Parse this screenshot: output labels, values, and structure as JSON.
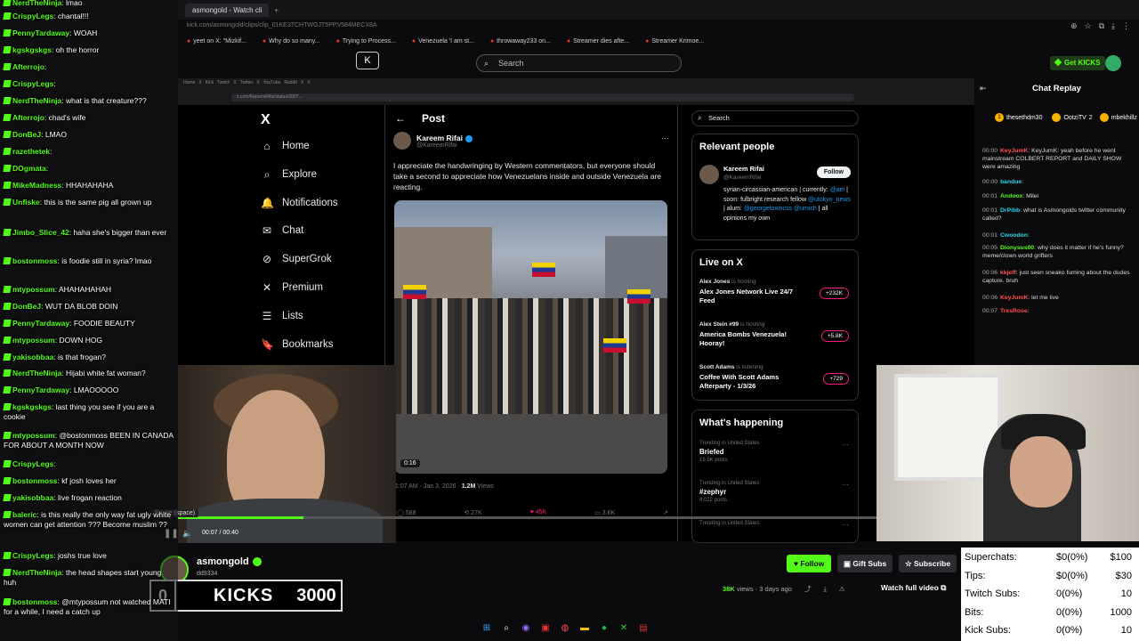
{
  "topbar": {
    "tab1": "asmongold - Watch cli",
    "tab2": "+",
    "url": "kick.com/asmongold/clips/clip_01KE3TCHTWGJT5PPV584MECX8A"
  },
  "bookmarks": [
    "yeet on X: \"Mizkif...",
    "Why do so many...",
    "Trying to Process...",
    "Venezuela 'I am st...",
    "throwaway233 on...",
    "Streamer dies afte...",
    "Streamer Krimoe..."
  ],
  "kick": {
    "logo_text": "K",
    "search_placeholder": "Search",
    "get_kicks": "Get KICKS"
  },
  "inner": {
    "address": "x.com/KareemRifai/status/2007...",
    "tabs": [
      "Home",
      "X",
      "Kick",
      "Twitch",
      "X",
      "Twitter",
      "X",
      "YouTube",
      "Reddit",
      "X",
      "X"
    ]
  },
  "x": {
    "logo": "X",
    "nav": [
      {
        "icon": "home-icon",
        "glyph": "⌂",
        "label": "Home"
      },
      {
        "icon": "explore-icon",
        "glyph": "⌕",
        "label": "Explore"
      },
      {
        "icon": "notifications-icon",
        "glyph": "🔔",
        "label": "Notifications"
      },
      {
        "icon": "chat-icon",
        "glyph": "✉",
        "label": "Chat"
      },
      {
        "icon": "supergrok-icon",
        "glyph": "⊘",
        "label": "SuperGrok"
      },
      {
        "icon": "premium-icon",
        "glyph": "✕",
        "label": "Premium"
      },
      {
        "icon": "lists-icon",
        "glyph": "☰",
        "label": "Lists"
      },
      {
        "icon": "bookmarks-icon",
        "glyph": "🔖",
        "label": "Bookmarks"
      }
    ],
    "post": {
      "back": "←",
      "header": "Post",
      "author": "Kareem Rifai",
      "handle": "@KareemRifai",
      "text": "I appreciate the handwringing by Western commentators, but everyone should take a second to appreciate how Venezuelans inside and outside Venezuela are reacting.",
      "video_time": "0:16",
      "meta_time": "1:07 AM · Jan 3, 2026 · ",
      "views": "1.2M",
      "views_label": " Views",
      "actions": [
        "588",
        "27K",
        "45K",
        "3.6K",
        "↗"
      ]
    },
    "search": "Search",
    "relevant": {
      "title": "Relevant people",
      "name": "Kareem Rifai",
      "handle": "@KareemRifai",
      "follow": "Follow",
      "bio_a": "syrian-circassian-american | currently: ",
      "bio_link1": "@aei",
      "bio_b": " | soon: fulbright research fellow ",
      "bio_link2": "@utokyo_news",
      "bio_c": " | alum: ",
      "bio_link3": "@georgetowncss @umich",
      "bio_d": " | all opinions my own"
    },
    "live": {
      "title": "Live on X",
      "items": [
        {
          "who": "Alex Jones",
          "status": " is hosting",
          "title": "Alex Jones Network Live 24/7 Feed",
          "count": "+232K"
        },
        {
          "who": "Alex Stein #99",
          "status": " is hosting",
          "title": "America Bombs Venezuela! Hooray!",
          "count": "+5.8K"
        },
        {
          "who": "Scott Adams",
          "status": " is listening",
          "title": "Coffee With Scott Adams Afterparty - 1/3/26",
          "count": "+729"
        }
      ]
    },
    "happening": {
      "title": "What's happening",
      "trends": [
        {
          "cat": "Trending in United States",
          "name": "Briefed",
          "posts": "19.5K posts"
        },
        {
          "cat": "Trending in United States",
          "name": "#zephyr",
          "posts": "4,022 posts"
        },
        {
          "cat": "Trending in United States",
          "name": "",
          "posts": ""
        }
      ]
    }
  },
  "player": {
    "pause_tip": "Pause (space)",
    "time": "00:07 / 00:40",
    "progress": 0.18
  },
  "channel": {
    "name": "asmongold",
    "sub": "dd9334",
    "follow": "Follow",
    "gift": "Gift Subs",
    "subscribe": "Subscribe",
    "views_num": "38K",
    "views_txt": " views · 3 days ago",
    "watch_full": "Watch full video"
  },
  "kicks_goal": {
    "current": "0",
    "label": "KICKS",
    "goal": "3000"
  },
  "chat": [
    {
      "user": "NerdTheNinja",
      "msg": "lmao"
    },
    {
      "user": "CrispyLegs",
      "msg": "chantal!!!"
    },
    {
      "user": "PennyTardaway",
      "msg": "WOAH"
    },
    {
      "user": "kgskgskgs",
      "msg": "oh the horror"
    },
    {
      "user": "Afterrojo",
      "msg": ""
    },
    {
      "user": "CrispyLegs",
      "msg": ""
    },
    {
      "user": "NerdTheNinja",
      "msg": "what is that creature???"
    },
    {
      "user": "Afterrojo",
      "msg": "chad's wife"
    },
    {
      "user": "DonBeJ",
      "msg": "LMAO"
    },
    {
      "user": "razethetek",
      "msg": ""
    },
    {
      "user": "DOgmata",
      "msg": ""
    },
    {
      "user": "MikeMadness",
      "msg": "HHAHAHAHA"
    },
    {
      "user": "Unfiske",
      "msg": "this is the same pig all grown up"
    },
    {
      "user": "Jimbo_Slice_42",
      "msg": "haha she's bigger than ever"
    },
    {
      "user": "bostonmoss",
      "msg": "is foodie still in syria? lmao"
    },
    {
      "user": "mtypossum",
      "msg": "AHAHAHAHAH"
    },
    {
      "user": "DonBeJ",
      "msg": "WUT DA BLOB DOIN"
    },
    {
      "user": "PennyTardaway",
      "msg": "FOODIE BEAUTY"
    },
    {
      "user": "mtypossum",
      "msg": "DOWN HOG"
    },
    {
      "user": "yakisobbaa",
      "msg": "is that frogan?"
    },
    {
      "user": "NerdTheNinja",
      "msg": "Hijabi white fat woman?"
    },
    {
      "user": "PennyTardaway",
      "msg": "LMAOOOOO"
    },
    {
      "user": "kgskgskgs",
      "msg": "last thing you see if you are a cookie"
    },
    {
      "user": "mtypossum",
      "msg": "@bostonmoss BEEN IN CANADA FOR ABOUT A MONTH NOW"
    },
    {
      "user": "CrispyLegs",
      "msg": ""
    },
    {
      "user": "bostonmoss",
      "msg": "kf josh loves her"
    },
    {
      "user": "yakisobbaa",
      "msg": "live frogan reaction"
    },
    {
      "user": "baleric",
      "msg": "is this really the only way fat ugly white women can get attention ??? Become muslim ??"
    },
    {
      "user": "CrispyLegs",
      "msg": "joshs true love"
    },
    {
      "user": "NerdTheNinja",
      "msg": "the head shapes start young huh"
    },
    {
      "user": "bostonmoss",
      "msg": "@mtypossum not watched MATI for a while, I need a catch up"
    }
  ],
  "replay": {
    "title": "Chat Replay",
    "pinned": [
      {
        "rank": "1",
        "user": "thesethdm30",
        "count": ""
      },
      {
        "rank": "",
        "user": "OotziTV",
        "count": "2"
      },
      {
        "rank": "",
        "user": "mbekhillz",
        "count": "1"
      }
    ],
    "messages": [
      {
        "time": "00:00",
        "user": "KeyJumK",
        "msg": "KeyJumK: yeah before he went mainstream COLBERT REPORT and DAILY SHOW were amazing",
        "style": "u"
      },
      {
        "time": "00:00",
        "user": "bandue",
        "msg": "",
        "style": "c"
      },
      {
        "time": "00:01",
        "user": "Andoox",
        "msg": "Milei",
        "style": "g"
      },
      {
        "time": "00:01",
        "user": "DrPibb",
        "msg": "what is Asmongolds twitter community called?",
        "style": "c"
      },
      {
        "time": "00:01",
        "user": "Cwoodon",
        "msg": "",
        "style": "c"
      },
      {
        "time": "00:05",
        "user": "Dionysus00",
        "msg": "why does it matter if he's funny? meme/clown world grifters",
        "style": "g"
      },
      {
        "time": "00:06",
        "user": "kkjeff",
        "msg": "just seen sneako fuming about the dudes capture. bruh",
        "style": "u"
      },
      {
        "time": "00:06",
        "user": "KeyJumK",
        "msg": "let me live",
        "style": "u"
      },
      {
        "time": "00:07",
        "user": "TresRose",
        "msg": "",
        "style": "u"
      }
    ]
  },
  "subs_panel": {
    "rows": [
      {
        "k": "Superchats:",
        "v": "$0(0%)",
        "g": "$100"
      },
      {
        "k": "Tips:",
        "v": "$0(0%)",
        "g": "$30"
      },
      {
        "k": "Twitch Subs:",
        "v": "0(0%)",
        "g": "10"
      },
      {
        "k": "Bits:",
        "v": "0(0%)",
        "g": "1000"
      },
      {
        "k": "Kick Subs:",
        "v": "0(0%)",
        "g": "10"
      }
    ]
  },
  "colors": {
    "kick_green": "#53fc18",
    "x_blue": "#1d9bf0",
    "x_pink": "#f91880"
  }
}
